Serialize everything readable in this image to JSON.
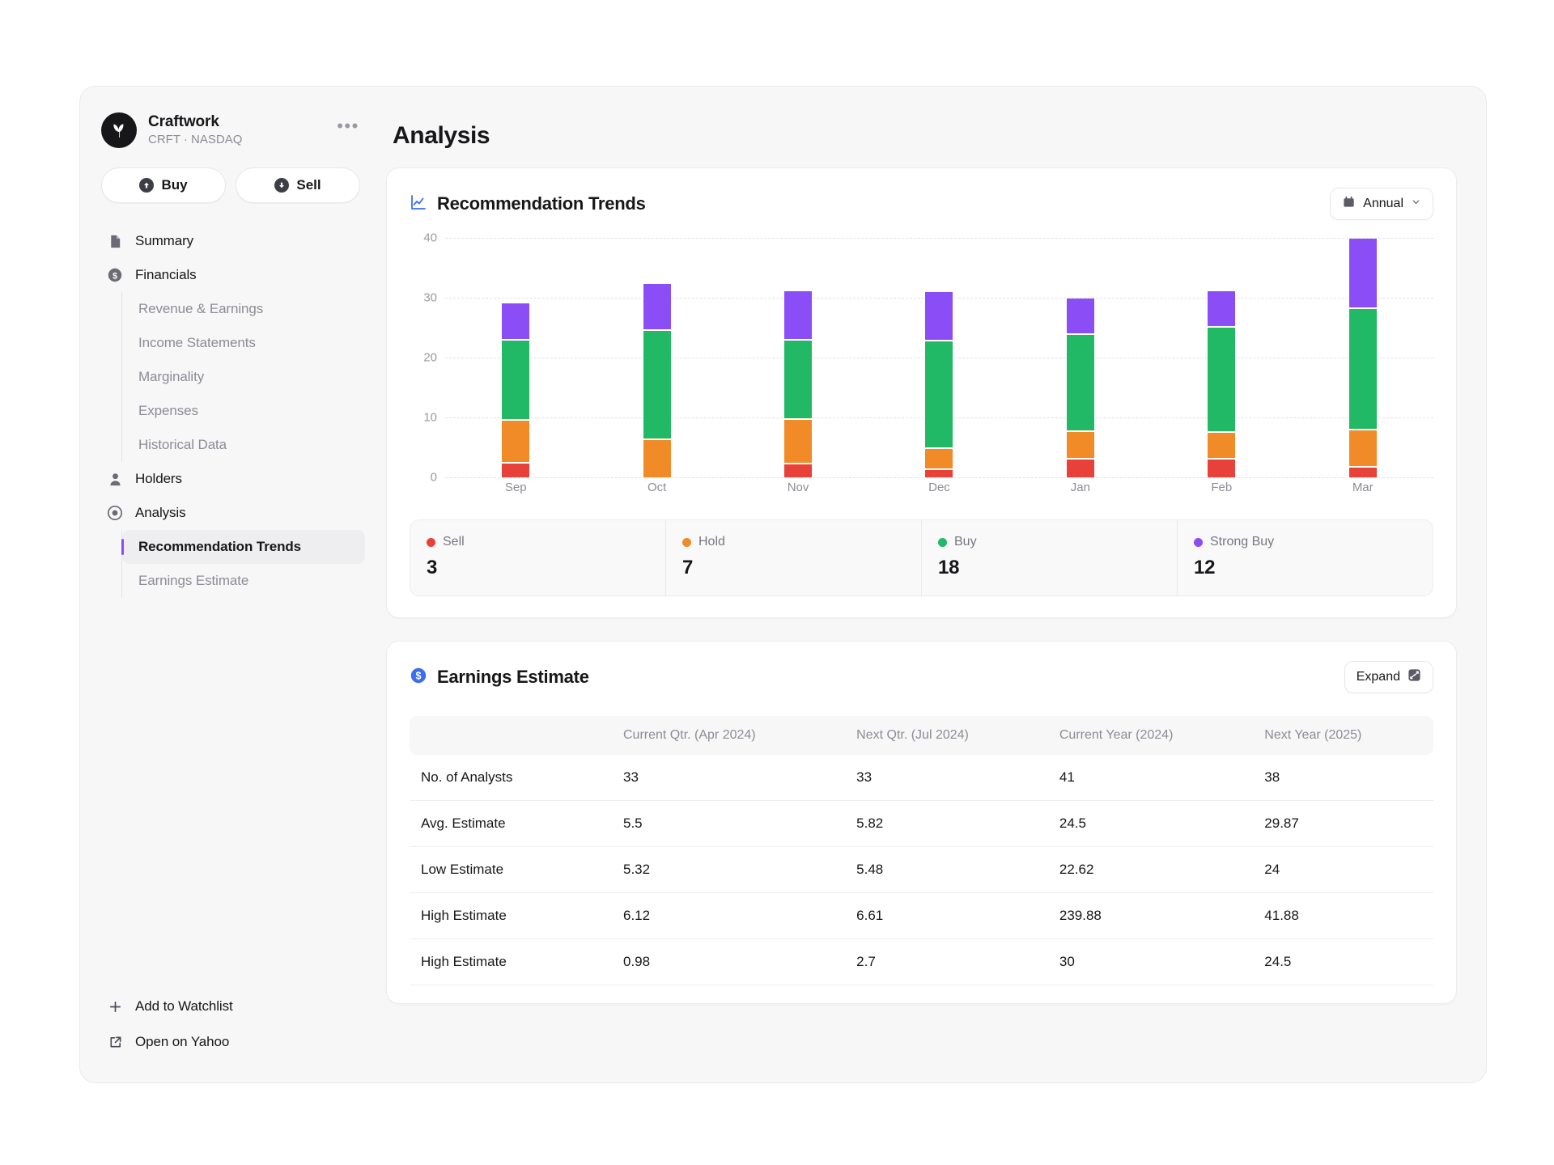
{
  "sidebar": {
    "brand": {
      "name": "Craftwork",
      "subtitle": "CRFT · NASDAQ",
      "logo_icon": "plant-leaf-icon",
      "more_icon": "ellipsis-icon"
    },
    "trade": {
      "buy_label": "Buy",
      "sell_label": "Sell"
    },
    "nav": [
      {
        "label": "Summary",
        "icon": "document-icon"
      },
      {
        "label": "Financials",
        "icon": "dollar-circle-icon"
      }
    ],
    "financials_children": [
      {
        "label": "Revenue & Earnings"
      },
      {
        "label": "Income Statements"
      },
      {
        "label": "Marginality"
      },
      {
        "label": "Expenses"
      },
      {
        "label": "Historical Data"
      }
    ],
    "holders": {
      "label": "Holders",
      "icon": "person-icon"
    },
    "analysis": {
      "label": "Analysis",
      "icon": "target-icon"
    },
    "analysis_children": [
      {
        "label": "Recommendation Trends",
        "active": true
      },
      {
        "label": "Earnings Estimate",
        "active": false
      }
    ],
    "footer": [
      {
        "label": "Add to Watchlist",
        "icon": "plus-icon"
      },
      {
        "label": "Open on Yahoo",
        "icon": "external-link-icon"
      }
    ],
    "active_accent": "#8b4df5"
  },
  "main": {
    "page_title": "Analysis"
  },
  "recommendation_card": {
    "title": "Recommendation Trends",
    "title_icon": "line-chart-icon",
    "period_button": {
      "label": "Annual",
      "icon": "calendar-icon",
      "chevron": "chevron-down-icon"
    },
    "stats": [
      {
        "label": "Sell",
        "value": "3",
        "color": "#e8413a"
      },
      {
        "label": "Hold",
        "value": "7",
        "color": "#f08b28"
      },
      {
        "label": "Buy",
        "value": "18",
        "color": "#22b966"
      },
      {
        "label": "Strong Buy",
        "value": "12",
        "color": "#8b4df5"
      }
    ]
  },
  "chart_data": {
    "type": "bar",
    "stacked": true,
    "title": "Recommendation Trends",
    "xlabel": "",
    "ylabel": "",
    "ylim": [
      0,
      40
    ],
    "yticks": [
      0,
      10,
      20,
      30,
      40
    ],
    "grid": true,
    "legend_position": "below",
    "categories": [
      "Sep",
      "Oct",
      "Nov",
      "Dec",
      "Jan",
      "Feb",
      "Mar"
    ],
    "series": [
      {
        "name": "Sell",
        "color": "#e8413a",
        "values": [
          2.3,
          0,
          2.2,
          1.2,
          3.0,
          3.0,
          1.6
        ]
      },
      {
        "name": "Hold",
        "color": "#f08b28",
        "values": [
          6.9,
          6.2,
          7.1,
          3.2,
          4.3,
          4.2,
          6.0
        ]
      },
      {
        "name": "Buy",
        "color": "#22b966",
        "values": [
          13.1,
          18.0,
          13.0,
          17.8,
          16.0,
          17.2,
          20.0
        ]
      },
      {
        "name": "Strong Buy",
        "color": "#8b4df5",
        "values": [
          6.0,
          7.6,
          8.0,
          8.0,
          5.8,
          5.9,
          11.5
        ]
      }
    ],
    "totals": [
      28.3,
      31.8,
      30.3,
      30.2,
      29.1,
      30.3,
      39.1
    ]
  },
  "earnings_card": {
    "title": "Earnings Estimate",
    "title_icon": "dollar-badge-icon",
    "expand_button": {
      "label": "Expand",
      "icon": "expand-icon"
    },
    "columns": [
      "",
      "Current Qtr. (Apr 2024)",
      "Next Qtr. (Jul 2024)",
      "Current Year (2024)",
      "Next Year (2025)"
    ],
    "rows": [
      {
        "label": "No. of Analysts",
        "values": [
          "33",
          "33",
          "41",
          "38"
        ]
      },
      {
        "label": "Avg. Estimate",
        "values": [
          "5.5",
          "5.82",
          "24.5",
          "29.87"
        ]
      },
      {
        "label": "Low Estimate",
        "values": [
          "5.32",
          "5.48",
          "22.62",
          "24"
        ]
      },
      {
        "label": "High Estimate",
        "values": [
          "6.12",
          "6.61",
          "239.88",
          "41.88"
        ]
      },
      {
        "label": "High Estimate",
        "values": [
          "0.98",
          "2.7",
          "30",
          "24.5"
        ]
      }
    ]
  }
}
